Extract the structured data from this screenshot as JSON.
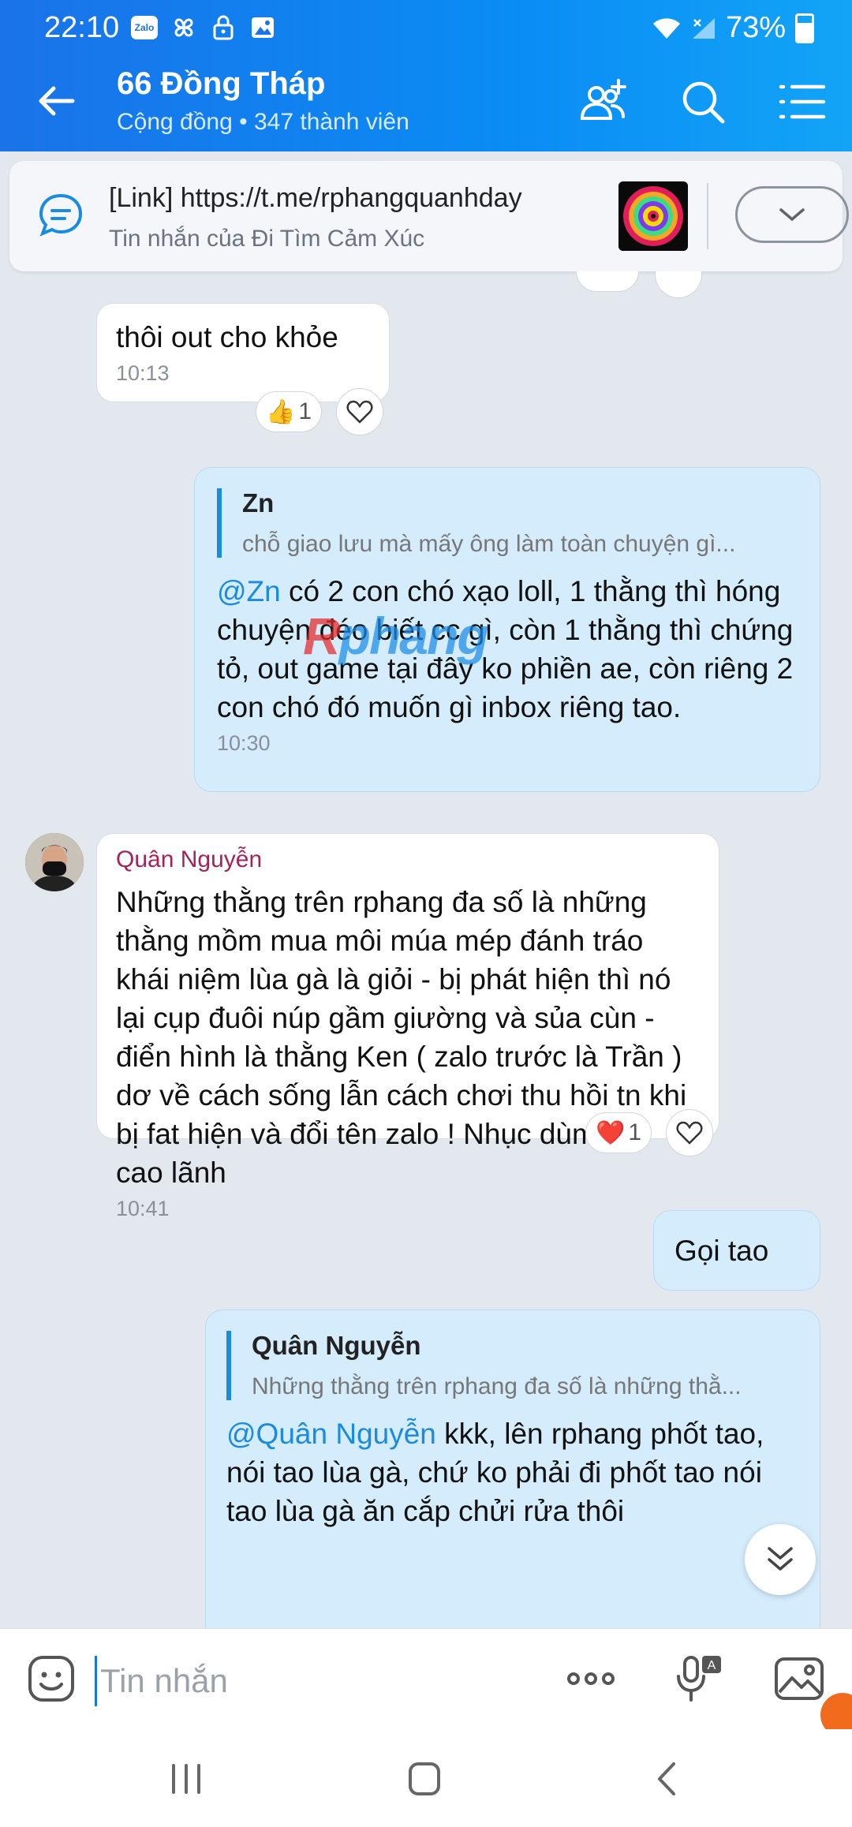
{
  "status": {
    "time": "22:10",
    "battery": "73%",
    "left_icons": [
      "zalo-icon",
      "pinwheel-icon",
      "lock-icon",
      "gallery-icon"
    ],
    "zalo_badge": "Zalo"
  },
  "header": {
    "title": "66 Đồng Tháp",
    "subtitle": "Cộng đồng • 347 thành viên",
    "icons": [
      "add-member-icon",
      "search-icon",
      "menu-icon"
    ]
  },
  "pinned": {
    "title": "[Link] https://t.me/rphangquanhday",
    "subtitle": "Tin nhắn của Đi Tìm Cảm Xúc"
  },
  "messages": [
    {
      "id": "m1",
      "direction": "in",
      "text": "thôi out cho khỏe",
      "time": "10:13",
      "reaction": {
        "emoji": "👍",
        "count": "1"
      }
    },
    {
      "id": "m2",
      "direction": "out",
      "quote_name": "Zn",
      "quote_text": "chỗ giao lưu mà mấy ông làm toàn chuyện gì...",
      "mention": "@Zn",
      "text": " có 2 con chó xạo loll, 1 thằng thì hóng chuyện đéo biết cc gì, còn 1 thằng thì chứng tỏ, out game tại đây ko phiền ae, còn riêng 2 con chó đó muốn gì inbox riêng tao.",
      "time": "10:30"
    },
    {
      "id": "m3",
      "direction": "in",
      "sender": "Quân Nguyễn",
      "text": "Những thằng trên rphang đa số là những thằng mồm mua môi múa mép đánh tráo khái niệm lùa gà là giỏi - bị phát hiện thì nó lại cụp đuôi núp gầm giường và sủa cùn - điển hình là thằng Ken ( zalo trước là Trần ) dơ về cách sống lẫn cách chơi thu hồi tn khi bị fat hiện và đổi tên zalo ! Nhục dùm đất cao lãnh",
      "time": "10:41",
      "reaction": {
        "emoji": "❤️",
        "count": "1"
      }
    },
    {
      "id": "m4",
      "direction": "out",
      "text": "Gọi tao"
    },
    {
      "id": "m5",
      "direction": "out",
      "quote_name": "Quân Nguyễn",
      "quote_text": "Những thằng trên rphang đa số là những thằ...",
      "mention": "@Quân Nguyễn",
      "text": " kkk, lên rphang phốt tao, nói tao lùa gà, chứ ko phải đi phốt tao nói tao lùa gà ăn cắp chửi rửa thôi"
    }
  ],
  "watermark": {
    "part1": "R",
    "part2": "phang"
  },
  "input": {
    "placeholder": "Tin nhắn"
  },
  "colors": {
    "header_start": "#1a73e8",
    "header_end": "#12a4f6",
    "outgoing_bubble": "#d4ecfc",
    "sender_name": "#a3245a",
    "mention": "#1a8be0"
  }
}
